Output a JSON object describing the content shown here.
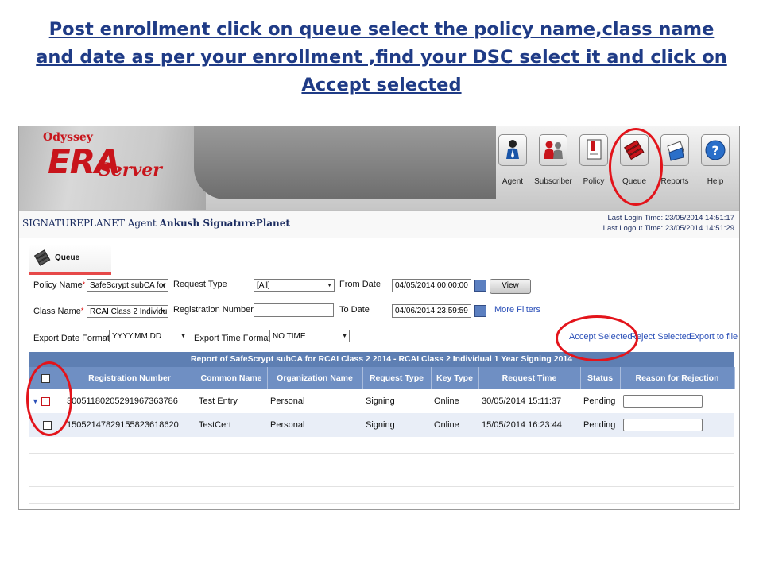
{
  "instruction": {
    "line1": "Post enrollment click on queue select the policy name,class name",
    "line2": "and date  as per your enrollment ,find your DSC select it and click on",
    "line3": "Accept selected"
  },
  "app": {
    "logo_odyssey": "Odyssey",
    "logo_era": "ERA",
    "logo_server": "Server",
    "nav": [
      {
        "label": "Agent",
        "icon": "agent-icon"
      },
      {
        "label": "Subscriber",
        "icon": "subscriber-icon"
      },
      {
        "label": "Policy",
        "icon": "policy-icon"
      },
      {
        "label": "Queue",
        "icon": "queue-icon"
      },
      {
        "label": "Reports",
        "icon": "reports-icon"
      },
      {
        "label": "Help",
        "icon": "help-icon"
      }
    ]
  },
  "infobar": {
    "org": "SIGNATUREPLANET Agent",
    "user": "Ankush SignaturePlanet",
    "last_login": "Last Login Time: 23/05/2014 14:51:17",
    "last_logout": "Last Logout Time: 23/05/2014 14:51:29"
  },
  "tab": {
    "label": "Queue"
  },
  "form": {
    "policy_label": "Policy Name",
    "policy_value": "SafeScrypt subCA for",
    "class_label": "Class Name",
    "class_value": "RCAI Class 2 Individu",
    "request_type_label": "Request Type",
    "request_type_value": "[All]",
    "registration_label": "Registration Number",
    "registration_value": "",
    "from_label": "From Date",
    "from_value": "04/05/2014  00:00:00",
    "to_label": "To Date",
    "to_value": "04/06/2014  23:59:59",
    "view_label": "View",
    "more_filters": "More Filters",
    "export_date_label": "Export Date Format",
    "export_date_value": "YYYY.MM.DD",
    "export_time_label": "Export Time Format",
    "export_time_value": "NO TIME",
    "accept_selected": "Accept Selected",
    "reject_selected": "Reject Selected",
    "export_file": "Export to file"
  },
  "report": {
    "title": "Report of SafeScrypt subCA for RCAI Class 2 2014 - RCAI Class 2 Individual 1 Year Signing 2014",
    "columns": [
      "Registration Number",
      "Common Name",
      "Organization Name",
      "Request Type",
      "Key Type",
      "Request Time",
      "Status",
      "Reason for Rejection"
    ],
    "rows": [
      {
        "reg": "30051180205291967363786",
        "cn": "Test Entry",
        "org": "Personal",
        "rtype": "Signing",
        "ktype": "Online",
        "time": "30/05/2014 15:11:37",
        "status": "Pending"
      },
      {
        "reg": "15052147829155823618620",
        "cn": "TestCert",
        "org": "Personal",
        "rtype": "Signing",
        "ktype": "Online",
        "time": "15/05/2014 16:23:44",
        "status": "Pending"
      }
    ]
  },
  "colors": {
    "annotation_ring": "#e3141b",
    "header_blue": "#6f8fc3",
    "link_blue": "#2a4fb8",
    "title_blue": "#1f3b86"
  }
}
